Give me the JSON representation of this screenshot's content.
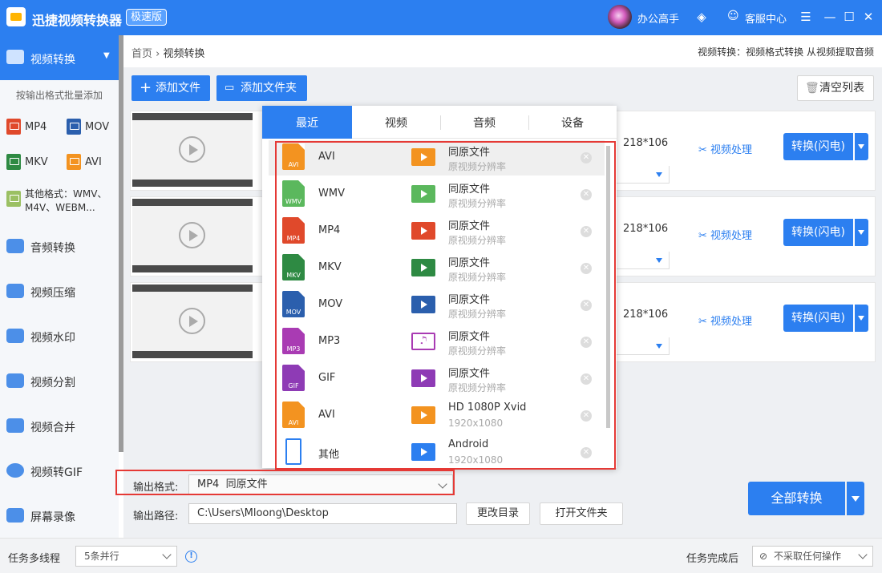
{
  "app": {
    "title": "迅捷视频转换器",
    "edition": "极速版",
    "user_name": "办公高手",
    "service": "客服中心"
  },
  "sidebar": {
    "active": "视频转换",
    "sub_label": "按输出格式批量添加",
    "formats": [
      {
        "label": "MP4",
        "color": "#e0492b"
      },
      {
        "label": "MOV",
        "color": "#2b5fad"
      },
      {
        "label": "MKV",
        "color": "#2e8a43"
      },
      {
        "label": "AVI",
        "color": "#f39320"
      }
    ],
    "other_formats": "其他格式：WMV、M4V、WEBM...",
    "items": [
      "音频转换",
      "视频压缩",
      "视频水印",
      "视频分割",
      "视频合并",
      "视频转GIF",
      "屏幕录像"
    ]
  },
  "main": {
    "breadcrumb_home": "首页",
    "breadcrumb_sep": "›",
    "breadcrumb_current": "视频转换",
    "top_tip": "视频转换：视频格式转换 从视频提取音频",
    "add_file": "添加文件",
    "add_folder": "添加文件夹",
    "clear_list": "清空列表",
    "rows": [
      {
        "resolution": "218*106",
        "process": "视频处理",
        "convert": "转换(闪电)"
      },
      {
        "resolution": "218*106",
        "process": "视频处理",
        "convert": "转换(闪电)"
      },
      {
        "resolution": "218*106",
        "process": "视频处理",
        "convert": "转换(闪电)"
      }
    ],
    "output_format_label": "输出格式:",
    "output_format_value": "MP4  同原文件",
    "output_path_label": "输出路径:",
    "output_path_value": "C:\\Users\\Mloong\\Desktop",
    "change_dir": "更改目录",
    "open_folder": "打开文件夹",
    "convert_all": "全部转换"
  },
  "popup": {
    "tabs": [
      "最近",
      "视频",
      "音频",
      "设备"
    ],
    "options": [
      {
        "format": "AVI",
        "icon_text": "AVI",
        "color": "#f39320",
        "q1": "同原文件",
        "q2": "原视频分辨率"
      },
      {
        "format": "WMV",
        "icon_text": "WMV",
        "color": "#5bb85d",
        "q1": "同原文件",
        "q2": "原视频分辨率"
      },
      {
        "format": "MP4",
        "icon_text": "MP4",
        "color": "#e0492b",
        "q1": "同原文件",
        "q2": "原视频分辨率"
      },
      {
        "format": "MKV",
        "icon_text": "MKV",
        "color": "#2e8a43",
        "q1": "同原文件",
        "q2": "原视频分辨率"
      },
      {
        "format": "MOV",
        "icon_text": "MOV",
        "color": "#2b5fad",
        "q1": "同原文件",
        "q2": "原视频分辨率"
      },
      {
        "format": "MP3",
        "icon_text": "MP3",
        "color": "#a93bb3",
        "q1": "同原文件",
        "q2": "原视频分辨率"
      },
      {
        "format": "GIF",
        "icon_text": "GIF",
        "color": "#8e3bb5",
        "q1": "同原文件",
        "q2": "原视频分辨率"
      },
      {
        "format": "AVI",
        "icon_text": "AVI",
        "color": "#f39320",
        "q1": "HD 1080P Xvid",
        "q2": "1920x1080"
      },
      {
        "format": "其他",
        "icon_text": "",
        "color": "#2c7ff0",
        "q1": "Android",
        "q2": "1920x1080"
      }
    ]
  },
  "status": {
    "threads_label": "任务多线程",
    "threads_value": "5条并行",
    "after_label": "任务完成后",
    "after_value": "不采取任何操作"
  }
}
